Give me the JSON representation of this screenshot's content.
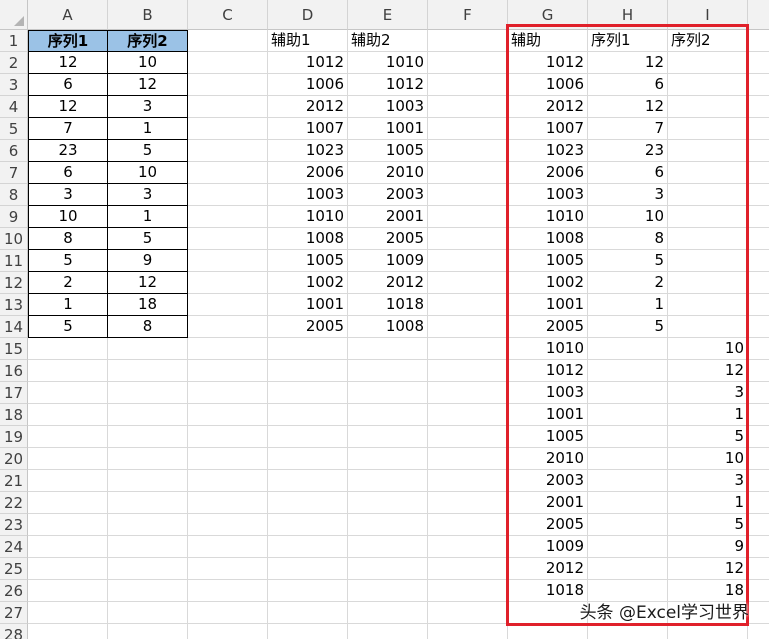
{
  "columns": [
    "A",
    "B",
    "C",
    "D",
    "E",
    "F",
    "G",
    "H",
    "I"
  ],
  "rows": [
    "1",
    "2",
    "3",
    "4",
    "5",
    "6",
    "7",
    "8",
    "9",
    "10",
    "11",
    "12",
    "13",
    "14",
    "15",
    "16",
    "17",
    "18",
    "19",
    "20",
    "21",
    "22",
    "23",
    "24",
    "25",
    "26",
    "27",
    "28"
  ],
  "table1": {
    "headers": [
      "序列1",
      "序列2"
    ],
    "rows": [
      [
        "12",
        "10"
      ],
      [
        "6",
        "12"
      ],
      [
        "12",
        "3"
      ],
      [
        "7",
        "1"
      ],
      [
        "23",
        "5"
      ],
      [
        "6",
        "10"
      ],
      [
        "3",
        "3"
      ],
      [
        "10",
        "1"
      ],
      [
        "8",
        "5"
      ],
      [
        "5",
        "9"
      ],
      [
        "2",
        "12"
      ],
      [
        "1",
        "18"
      ],
      [
        "5",
        "8"
      ]
    ]
  },
  "table2": {
    "headers": [
      "辅助1",
      "辅助2"
    ],
    "rows": [
      [
        "1012",
        "1010"
      ],
      [
        "1006",
        "1012"
      ],
      [
        "2012",
        "1003"
      ],
      [
        "1007",
        "1001"
      ],
      [
        "1023",
        "1005"
      ],
      [
        "2006",
        "2010"
      ],
      [
        "1003",
        "2003"
      ],
      [
        "1010",
        "2001"
      ],
      [
        "1008",
        "2005"
      ],
      [
        "1005",
        "1009"
      ],
      [
        "1002",
        "2012"
      ],
      [
        "1001",
        "1018"
      ],
      [
        "2005",
        "1008"
      ]
    ]
  },
  "table3": {
    "headers": [
      "辅助",
      "序列1",
      "序列2"
    ],
    "rows": [
      [
        "1012",
        "12",
        ""
      ],
      [
        "1006",
        "6",
        ""
      ],
      [
        "2012",
        "12",
        ""
      ],
      [
        "1007",
        "7",
        ""
      ],
      [
        "1023",
        "23",
        ""
      ],
      [
        "2006",
        "6",
        ""
      ],
      [
        "1003",
        "3",
        ""
      ],
      [
        "1010",
        "10",
        ""
      ],
      [
        "1008",
        "8",
        ""
      ],
      [
        "1005",
        "5",
        ""
      ],
      [
        "1002",
        "2",
        ""
      ],
      [
        "1001",
        "1",
        ""
      ],
      [
        "2005",
        "5",
        ""
      ],
      [
        "1010",
        "",
        "10"
      ],
      [
        "1012",
        "",
        "12"
      ],
      [
        "1003",
        "",
        "3"
      ],
      [
        "1001",
        "",
        "1"
      ],
      [
        "1005",
        "",
        "5"
      ],
      [
        "2010",
        "",
        "10"
      ],
      [
        "2003",
        "",
        "3"
      ],
      [
        "2001",
        "",
        "1"
      ],
      [
        "2005",
        "",
        "5"
      ],
      [
        "1009",
        "",
        "9"
      ],
      [
        "2012",
        "",
        "12"
      ],
      [
        "1018",
        "",
        "18"
      ]
    ]
  },
  "colors": {
    "header_fill": "#9bc2e6",
    "highlight_border": "#e0202a",
    "gridline": "#d9d9d9",
    "header_bg": "#f2f2f2"
  },
  "watermark": "头条 @Excel学习世界"
}
